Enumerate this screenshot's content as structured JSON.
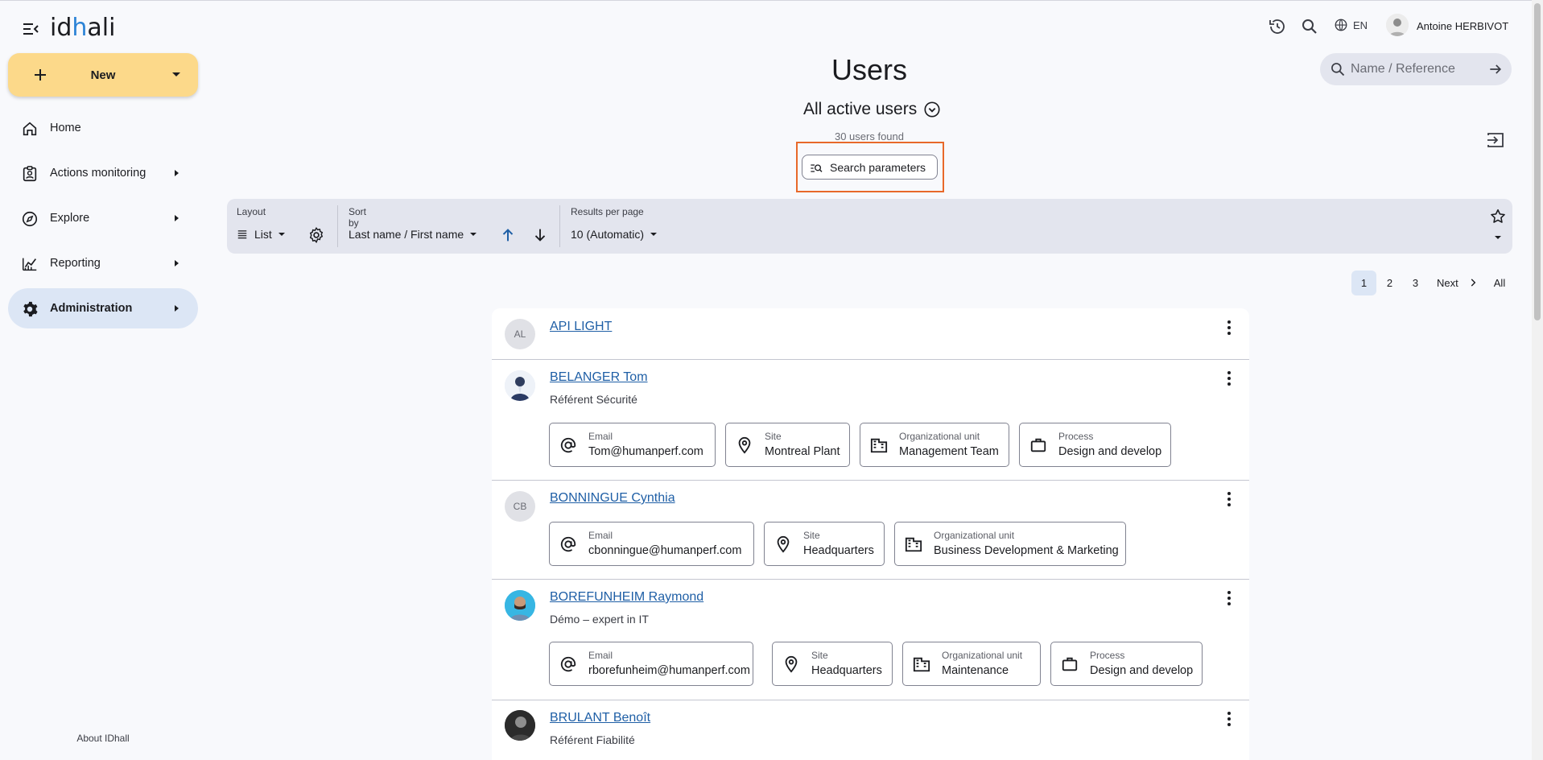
{
  "app": {
    "logo_text_pre": "id",
    "logo_text_dot": "h",
    "logo_text_post": "ali"
  },
  "sidebar": {
    "new_label": "New",
    "items": [
      {
        "label": "Home",
        "icon": "home-icon"
      },
      {
        "label": "Actions monitoring",
        "icon": "clipboard-user-icon"
      },
      {
        "label": "Explore",
        "icon": "compass-icon"
      },
      {
        "label": "Reporting",
        "icon": "chart-line-icon"
      },
      {
        "label": "Administration",
        "icon": "gear-icon",
        "active": true
      }
    ],
    "about": "About IDhall"
  },
  "header": {
    "language": "EN",
    "user_name": "Antoine HERBIVOT",
    "search_placeholder": "Name / Reference"
  },
  "page": {
    "title": "Users",
    "view": "All active users",
    "count_text": "30 users found",
    "search_params_label": "Search parameters"
  },
  "toolbar": {
    "layout_label": "Layout",
    "layout_value": "List",
    "sort_label": "Sort by",
    "sort_value": "Last name / First name",
    "results_label": "Results per page",
    "results_value": "10 (Automatic)"
  },
  "pagination": {
    "pages": [
      "1",
      "2",
      "3"
    ],
    "current": "1",
    "next": "Next",
    "all": "All"
  },
  "users": [
    {
      "initials": "AL",
      "name": "API LIGHT",
      "role": "",
      "chips": []
    },
    {
      "initials": "",
      "name": "BELANGER Tom",
      "role": "Référent Sécurité",
      "chips": [
        {
          "label": "Email",
          "value": "Tom@humanperf.com",
          "icon": "at-icon"
        },
        {
          "label": "Site",
          "value": "Montreal Plant",
          "icon": "location-pin-icon"
        },
        {
          "label": "Organizational unit",
          "value": "Management Team",
          "icon": "building-icon"
        },
        {
          "label": "Process",
          "value": "Design and develop",
          "icon": "briefcase-icon"
        }
      ]
    },
    {
      "initials": "CB",
      "name": "BONNINGUE Cynthia",
      "role": "",
      "chips": [
        {
          "label": "Email",
          "value": "cbonningue@humanperf.com",
          "icon": "at-icon"
        },
        {
          "label": "Site",
          "value": "Headquarters",
          "icon": "location-pin-icon"
        },
        {
          "label": "Organizational unit",
          "value": "Business Development & Marketing",
          "icon": "building-icon"
        }
      ]
    },
    {
      "initials": "",
      "name": "BOREFUNHEIM Raymond",
      "role": "Démo – expert in IT",
      "chips": [
        {
          "label": "Email",
          "value": "rborefunheim@humanperf.com",
          "icon": "at-icon"
        },
        {
          "label": "Site",
          "value": "Headquarters",
          "icon": "location-pin-icon"
        },
        {
          "label": "Organizational unit",
          "value": "Maintenance",
          "icon": "building-icon"
        },
        {
          "label": "Process",
          "value": "Design and develop",
          "icon": "briefcase-icon"
        }
      ]
    },
    {
      "initials": "",
      "name": "BRULANT Benoît",
      "role": "Référent Fiabilité",
      "chips": []
    }
  ],
  "colors": {
    "accent": "#fcd98a",
    "active_nav": "#dce6f5",
    "link": "#1f5fa6",
    "highlight": "#e8692a",
    "toolbar_bg": "#e3e5ee"
  }
}
